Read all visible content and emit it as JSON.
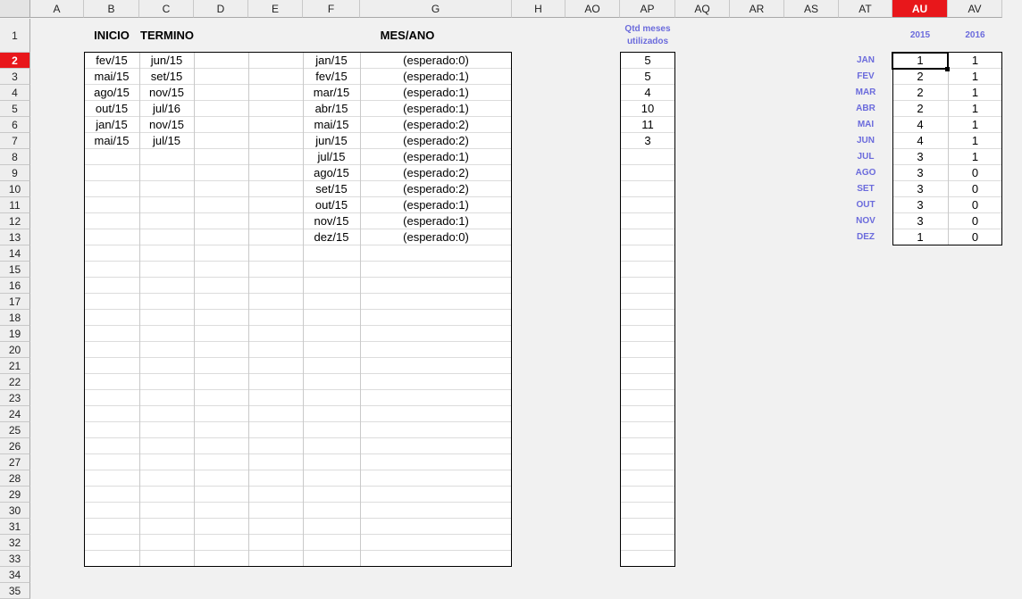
{
  "columns": [
    "A",
    "B",
    "C",
    "D",
    "E",
    "F",
    "G",
    "H",
    "AO",
    "AP",
    "AQ",
    "AR",
    "AS",
    "AT",
    "AU",
    "AV"
  ],
  "active_column": "AU",
  "active_row": "2",
  "rows": [
    "1",
    "2",
    "3",
    "4",
    "5",
    "6",
    "7",
    "8",
    "9",
    "10",
    "11",
    "12",
    "13",
    "14",
    "15",
    "16",
    "17",
    "18",
    "19",
    "20",
    "21",
    "22",
    "23",
    "24",
    "25",
    "26",
    "27",
    "28",
    "29",
    "30",
    "31",
    "32",
    "33",
    "34",
    "35"
  ],
  "headers": {
    "inicio": "INICIO",
    "termino": "TERMINO",
    "mes_ano": "MES/ANO",
    "qtd_line1": "Qtd meses",
    "qtd_line2": "utilizados",
    "year_2015": "2015",
    "year_2016": "2016"
  },
  "periods": [
    {
      "inicio": "fev/15",
      "termino": "jun/15"
    },
    {
      "inicio": "mai/15",
      "termino": "set/15"
    },
    {
      "inicio": "ago/15",
      "termino": "nov/15"
    },
    {
      "inicio": "out/15",
      "termino": "jul/16"
    },
    {
      "inicio": "jan/15",
      "termino": "nov/15"
    },
    {
      "inicio": "mai/15",
      "termino": "jul/15"
    }
  ],
  "months": [
    {
      "mes": "jan/15",
      "esperado": "(esperado:0)"
    },
    {
      "mes": "fev/15",
      "esperado": "(esperado:1)"
    },
    {
      "mes": "mar/15",
      "esperado": "(esperado:1)"
    },
    {
      "mes": "abr/15",
      "esperado": "(esperado:1)"
    },
    {
      "mes": "mai/15",
      "esperado": "(esperado:2)"
    },
    {
      "mes": "jun/15",
      "esperado": "(esperado:2)"
    },
    {
      "mes": "jul/15",
      "esperado": "(esperado:1)"
    },
    {
      "mes": "ago/15",
      "esperado": "(esperado:2)"
    },
    {
      "mes": "set/15",
      "esperado": "(esperado:2)"
    },
    {
      "mes": "out/15",
      "esperado": "(esperado:1)"
    },
    {
      "mes": "nov/15",
      "esperado": "(esperado:1)"
    },
    {
      "mes": "dez/15",
      "esperado": "(esperado:0)"
    }
  ],
  "qtd_meses": [
    "5",
    "5",
    "4",
    "10",
    "11",
    "3"
  ],
  "summary": [
    {
      "month": "JAN",
      "y2015": "1",
      "y2016": "1"
    },
    {
      "month": "FEV",
      "y2015": "2",
      "y2016": "1"
    },
    {
      "month": "MAR",
      "y2015": "2",
      "y2016": "1"
    },
    {
      "month": "ABR",
      "y2015": "2",
      "y2016": "1"
    },
    {
      "month": "MAI",
      "y2015": "4",
      "y2016": "1"
    },
    {
      "month": "JUN",
      "y2015": "4",
      "y2016": "1"
    },
    {
      "month": "JUL",
      "y2015": "3",
      "y2016": "1"
    },
    {
      "month": "AGO",
      "y2015": "3",
      "y2016": "0"
    },
    {
      "month": "SET",
      "y2015": "3",
      "y2016": "0"
    },
    {
      "month": "OUT",
      "y2015": "3",
      "y2016": "0"
    },
    {
      "month": "NOV",
      "y2015": "3",
      "y2016": "0"
    },
    {
      "month": "DEZ",
      "y2015": "1",
      "y2016": "0"
    }
  ]
}
